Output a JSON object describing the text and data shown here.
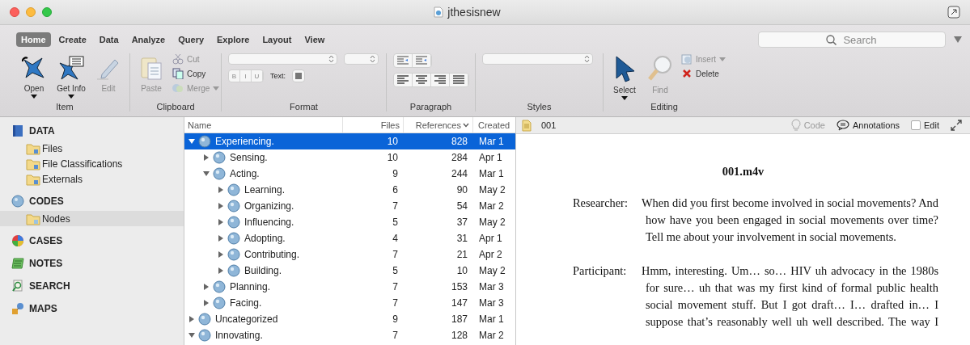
{
  "window": {
    "title": "jthesisnew"
  },
  "ribbon_tabs": [
    {
      "label": "Home",
      "selected": true
    },
    {
      "label": "Create",
      "selected": false
    },
    {
      "label": "Data",
      "selected": false
    },
    {
      "label": "Analyze",
      "selected": false
    },
    {
      "label": "Query",
      "selected": false
    },
    {
      "label": "Explore",
      "selected": false
    },
    {
      "label": "Layout",
      "selected": false
    },
    {
      "label": "View",
      "selected": false
    }
  ],
  "search": {
    "placeholder": "Search"
  },
  "ribbon_groups": [
    {
      "label": "Item",
      "kind": "item",
      "buttons": [
        {
          "label": "Open",
          "disabled": false,
          "menu": true
        },
        {
          "label": "Get Info",
          "disabled": false,
          "menu": true
        },
        {
          "label": "Edit",
          "disabled": true,
          "menu": false
        }
      ]
    },
    {
      "label": "Clipboard",
      "kind": "clipboard",
      "buttons": [
        {
          "label": "Paste",
          "disabled": true,
          "menu": false
        }
      ],
      "small_buttons": [
        {
          "label": "Cut",
          "disabled": true,
          "menu": false
        },
        {
          "label": "Copy",
          "disabled": false,
          "menu": false
        },
        {
          "label": "Merge",
          "disabled": true,
          "menu": true
        }
      ]
    },
    {
      "label": "Format",
      "kind": "format",
      "styles": [
        "B",
        "I",
        "U"
      ],
      "text_color_label": "Text:"
    },
    {
      "label": "Paragraph",
      "kind": "paragraph"
    },
    {
      "label": "Styles",
      "kind": "styles"
    },
    {
      "label": "Editing",
      "kind": "editing",
      "buttons": [
        {
          "label": "Select",
          "disabled": false,
          "menu": true
        },
        {
          "label": "Find",
          "disabled": true,
          "menu": false
        }
      ],
      "small_buttons": [
        {
          "label": "Insert",
          "disabled": true,
          "menu": true
        },
        {
          "label": "Delete",
          "disabled": false,
          "menu": false
        }
      ]
    }
  ],
  "sidebar": {
    "sections": [
      {
        "label": "DATA",
        "items": [
          {
            "label": "Files",
            "selected": false
          },
          {
            "label": "File Classifications",
            "selected": false
          },
          {
            "label": "Externals",
            "selected": false
          }
        ]
      },
      {
        "label": "CODES",
        "items": [
          {
            "label": "Nodes",
            "selected": true
          }
        ]
      },
      {
        "label": "CASES"
      },
      {
        "label": "NOTES"
      },
      {
        "label": "SEARCH"
      },
      {
        "label": "MAPS"
      }
    ]
  },
  "table": {
    "columns": [
      {
        "label": "Name",
        "sorted": false
      },
      {
        "label": "Files",
        "sorted": false
      },
      {
        "label": "References",
        "sorted": true
      },
      {
        "label": "Created",
        "sorted": false
      }
    ],
    "rows": [
      {
        "name": "Experiencing.",
        "files": "10",
        "references": "828",
        "created": "Mar 1",
        "selected": true,
        "expanded": true,
        "children": [
          {
            "name": "Sensing.",
            "files": "10",
            "references": "284",
            "created": "Apr 1",
            "selected": false,
            "expanded": false
          },
          {
            "name": "Acting.",
            "files": "9",
            "references": "244",
            "created": "Mar 1",
            "selected": false,
            "expanded": true,
            "children": [
              {
                "name": "Learning.",
                "files": "6",
                "references": "90",
                "created": "May 2",
                "selected": false,
                "expanded": false
              },
              {
                "name": "Organizing.",
                "files": "7",
                "references": "54",
                "created": "Mar 2",
                "selected": false,
                "expanded": false
              },
              {
                "name": "Influencing.",
                "files": "5",
                "references": "37",
                "created": "May 2",
                "selected": false,
                "expanded": false
              },
              {
                "name": "Adopting.",
                "files": "4",
                "references": "31",
                "created": "Apr 1",
                "selected": false,
                "expanded": false
              },
              {
                "name": "Contributing.",
                "files": "7",
                "references": "21",
                "created": "Apr 2",
                "selected": false,
                "expanded": false
              },
              {
                "name": "Building.",
                "files": "5",
                "references": "10",
                "created": "May 2",
                "selected": false,
                "expanded": false
              }
            ]
          },
          {
            "name": "Planning.",
            "files": "7",
            "references": "153",
            "created": "Mar 3",
            "selected": false,
            "expanded": false
          },
          {
            "name": "Facing.",
            "files": "7",
            "references": "147",
            "created": "Mar 3",
            "selected": false,
            "expanded": false
          }
        ]
      },
      {
        "name": "Uncategorized",
        "files": "9",
        "references": "187",
        "created": "Mar 1",
        "selected": false,
        "expanded": false
      },
      {
        "name": "Innovating.",
        "files": "7",
        "references": "128",
        "created": "Mar 2",
        "selected": false,
        "expanded": true
      }
    ]
  },
  "detail": {
    "title": "001",
    "code_label": "Code",
    "annotations_label": "Annotations",
    "edit": {
      "label": "Edit",
      "checked": false
    },
    "document_title": "001.m4v",
    "turns": [
      {
        "speaker": "Researcher:",
        "text": "When did you first become involved in social movements? And how have you been engaged in social movements over time? Tell me about your involvement in social movements."
      },
      {
        "speaker": "Participant:",
        "text": "Hmm, interesting. Um… so… HIV uh advocacy in the 1980s for sure… uh that was my first kind of formal public health social movement stuff. But I got draft… I… drafted in… I suppose that’s reasonably well uh well described. The way I"
      }
    ]
  }
}
